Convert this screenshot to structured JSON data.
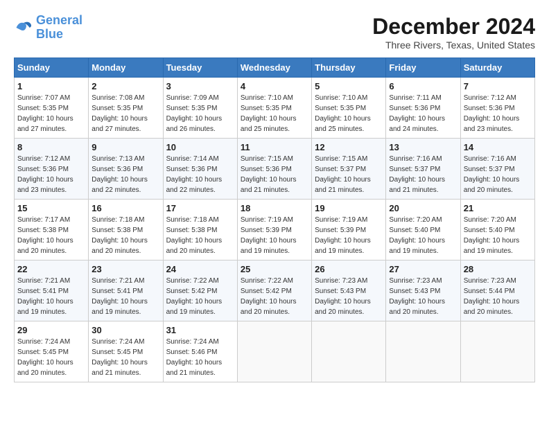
{
  "logo": {
    "line1": "General",
    "line2": "Blue"
  },
  "title": "December 2024",
  "subtitle": "Three Rivers, Texas, United States",
  "headers": [
    "Sunday",
    "Monday",
    "Tuesday",
    "Wednesday",
    "Thursday",
    "Friday",
    "Saturday"
  ],
  "weeks": [
    [
      {
        "day": "1",
        "sunrise": "7:07 AM",
        "sunset": "5:35 PM",
        "daylight": "10 hours and 27 minutes."
      },
      {
        "day": "2",
        "sunrise": "7:08 AM",
        "sunset": "5:35 PM",
        "daylight": "10 hours and 27 minutes."
      },
      {
        "day": "3",
        "sunrise": "7:09 AM",
        "sunset": "5:35 PM",
        "daylight": "10 hours and 26 minutes."
      },
      {
        "day": "4",
        "sunrise": "7:10 AM",
        "sunset": "5:35 PM",
        "daylight": "10 hours and 25 minutes."
      },
      {
        "day": "5",
        "sunrise": "7:10 AM",
        "sunset": "5:35 PM",
        "daylight": "10 hours and 25 minutes."
      },
      {
        "day": "6",
        "sunrise": "7:11 AM",
        "sunset": "5:36 PM",
        "daylight": "10 hours and 24 minutes."
      },
      {
        "day": "7",
        "sunrise": "7:12 AM",
        "sunset": "5:36 PM",
        "daylight": "10 hours and 23 minutes."
      }
    ],
    [
      {
        "day": "8",
        "sunrise": "7:12 AM",
        "sunset": "5:36 PM",
        "daylight": "10 hours and 23 minutes."
      },
      {
        "day": "9",
        "sunrise": "7:13 AM",
        "sunset": "5:36 PM",
        "daylight": "10 hours and 22 minutes."
      },
      {
        "day": "10",
        "sunrise": "7:14 AM",
        "sunset": "5:36 PM",
        "daylight": "10 hours and 22 minutes."
      },
      {
        "day": "11",
        "sunrise": "7:15 AM",
        "sunset": "5:36 PM",
        "daylight": "10 hours and 21 minutes."
      },
      {
        "day": "12",
        "sunrise": "7:15 AM",
        "sunset": "5:37 PM",
        "daylight": "10 hours and 21 minutes."
      },
      {
        "day": "13",
        "sunrise": "7:16 AM",
        "sunset": "5:37 PM",
        "daylight": "10 hours and 21 minutes."
      },
      {
        "day": "14",
        "sunrise": "7:16 AM",
        "sunset": "5:37 PM",
        "daylight": "10 hours and 20 minutes."
      }
    ],
    [
      {
        "day": "15",
        "sunrise": "7:17 AM",
        "sunset": "5:38 PM",
        "daylight": "10 hours and 20 minutes."
      },
      {
        "day": "16",
        "sunrise": "7:18 AM",
        "sunset": "5:38 PM",
        "daylight": "10 hours and 20 minutes."
      },
      {
        "day": "17",
        "sunrise": "7:18 AM",
        "sunset": "5:38 PM",
        "daylight": "10 hours and 20 minutes."
      },
      {
        "day": "18",
        "sunrise": "7:19 AM",
        "sunset": "5:39 PM",
        "daylight": "10 hours and 19 minutes."
      },
      {
        "day": "19",
        "sunrise": "7:19 AM",
        "sunset": "5:39 PM",
        "daylight": "10 hours and 19 minutes."
      },
      {
        "day": "20",
        "sunrise": "7:20 AM",
        "sunset": "5:40 PM",
        "daylight": "10 hours and 19 minutes."
      },
      {
        "day": "21",
        "sunrise": "7:20 AM",
        "sunset": "5:40 PM",
        "daylight": "10 hours and 19 minutes."
      }
    ],
    [
      {
        "day": "22",
        "sunrise": "7:21 AM",
        "sunset": "5:41 PM",
        "daylight": "10 hours and 19 minutes."
      },
      {
        "day": "23",
        "sunrise": "7:21 AM",
        "sunset": "5:41 PM",
        "daylight": "10 hours and 19 minutes."
      },
      {
        "day": "24",
        "sunrise": "7:22 AM",
        "sunset": "5:42 PM",
        "daylight": "10 hours and 19 minutes."
      },
      {
        "day": "25",
        "sunrise": "7:22 AM",
        "sunset": "5:42 PM",
        "daylight": "10 hours and 20 minutes."
      },
      {
        "day": "26",
        "sunrise": "7:23 AM",
        "sunset": "5:43 PM",
        "daylight": "10 hours and 20 minutes."
      },
      {
        "day": "27",
        "sunrise": "7:23 AM",
        "sunset": "5:43 PM",
        "daylight": "10 hours and 20 minutes."
      },
      {
        "day": "28",
        "sunrise": "7:23 AM",
        "sunset": "5:44 PM",
        "daylight": "10 hours and 20 minutes."
      }
    ],
    [
      {
        "day": "29",
        "sunrise": "7:24 AM",
        "sunset": "5:45 PM",
        "daylight": "10 hours and 20 minutes."
      },
      {
        "day": "30",
        "sunrise": "7:24 AM",
        "sunset": "5:45 PM",
        "daylight": "10 hours and 21 minutes."
      },
      {
        "day": "31",
        "sunrise": "7:24 AM",
        "sunset": "5:46 PM",
        "daylight": "10 hours and 21 minutes."
      },
      null,
      null,
      null,
      null
    ]
  ],
  "labels": {
    "sunrise": "Sunrise:",
    "sunset": "Sunset:",
    "daylight": "Daylight:"
  }
}
